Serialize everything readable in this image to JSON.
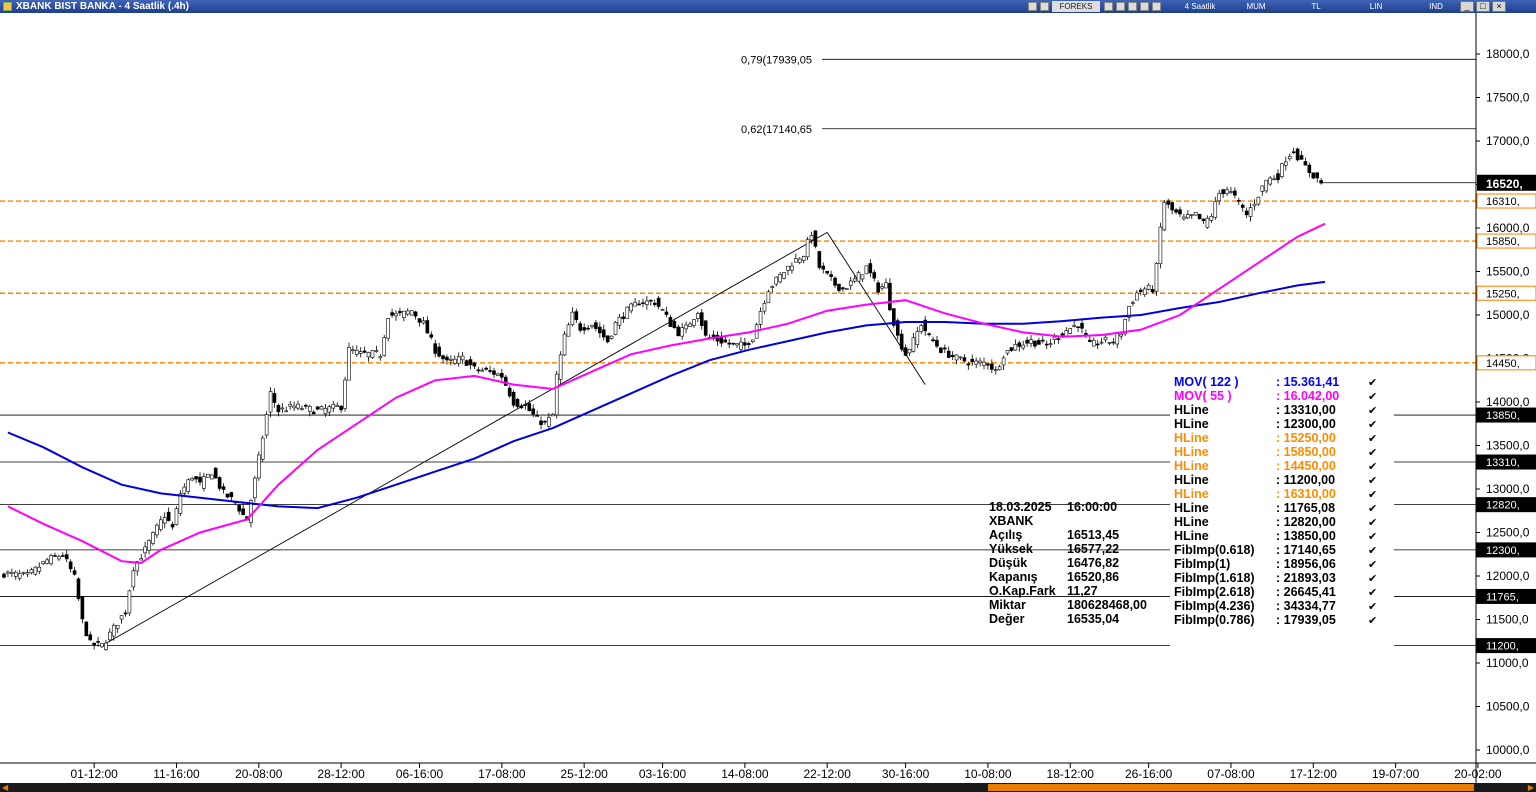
{
  "window": {
    "title": "XBANK BIST BANKA - 4 Saatlik (.4h)",
    "toolbar": {
      "source": "FOREKS",
      "period": "4 Saatlik",
      "chart_style": "MUM",
      "currency": "TL",
      "scale": "LIN",
      "indicators": "IND"
    },
    "buttons": {
      "minimize": "_",
      "maximize": "□",
      "close": "×"
    }
  },
  "chart_data": {
    "type": "candlestick",
    "symbol": "XBANK",
    "y_axis": {
      "range": [
        9800,
        18400
      ],
      "ticks": [
        "10000,0",
        "10500,0",
        "11000,0",
        "11500,0",
        "12000,0",
        "12500,0",
        "13000,0",
        "13500,0",
        "14000,0",
        "14500,0",
        "15000,0",
        "15500,0",
        "16000,0",
        "16500,0",
        "17000,0",
        "17500,0",
        "18000,0"
      ],
      "tick_values": [
        10000,
        10500,
        11000,
        11500,
        12000,
        12500,
        13000,
        13500,
        14000,
        14500,
        15000,
        15500,
        16000,
        16500,
        17000,
        17500,
        18000
      ]
    },
    "x_axis": {
      "bar_count": 370,
      "ticks": [
        "01-12:00",
        "11-16:00",
        "20-08:00",
        "28-12:00",
        "06-16:00",
        "17-08:00",
        "25-12:00",
        "03-16:00",
        "14-08:00",
        "22-12:00",
        "30-16:00",
        "10-08:00",
        "18-12:00",
        "26-16:00",
        "07-08:00",
        "17-12:00",
        "19-07:00",
        "20-02:00"
      ],
      "tick_bars": [
        23,
        44,
        65,
        86,
        106,
        127,
        148,
        168,
        189,
        210,
        230,
        251,
        272,
        292,
        313,
        334,
        355,
        376
      ]
    },
    "price_path": [
      [
        0,
        12030
      ],
      [
        6,
        12000
      ],
      [
        11,
        12180
      ],
      [
        15,
        12250
      ],
      [
        18,
        11980
      ],
      [
        20,
        11480
      ],
      [
        22,
        11220
      ],
      [
        25,
        11200
      ],
      [
        28,
        11400
      ],
      [
        31,
        11600
      ],
      [
        33,
        12100
      ],
      [
        36,
        12300
      ],
      [
        39,
        12550
      ],
      [
        41,
        12700
      ],
      [
        43,
        12550
      ],
      [
        45,
        12950
      ],
      [
        48,
        13150
      ],
      [
        50,
        13050
      ],
      [
        53,
        13200
      ],
      [
        56,
        12950
      ],
      [
        59,
        12850
      ],
      [
        61,
        12700
      ],
      [
        62,
        12650
      ],
      [
        64,
        13100
      ],
      [
        66,
        13600
      ],
      [
        68,
        14100
      ],
      [
        70,
        13900
      ],
      [
        74,
        13950
      ],
      [
        80,
        13900
      ],
      [
        86,
        13950
      ],
      [
        88,
        14600
      ],
      [
        91,
        14550
      ],
      [
        96,
        14550
      ],
      [
        98,
        15000
      ],
      [
        101,
        15000
      ],
      [
        104,
        15050
      ],
      [
        107,
        14900
      ],
      [
        110,
        14600
      ],
      [
        113,
        14450
      ],
      [
        117,
        14500
      ],
      [
        120,
        14380
      ],
      [
        124,
        14350
      ],
      [
        127,
        14300
      ],
      [
        130,
        14000
      ],
      [
        133,
        13950
      ],
      [
        136,
        13800
      ],
      [
        138,
        13750
      ],
      [
        140,
        13850
      ],
      [
        141,
        14300
      ],
      [
        143,
        14750
      ],
      [
        145,
        15000
      ],
      [
        147,
        14850
      ],
      [
        150,
        14900
      ],
      [
        154,
        14700
      ],
      [
        156,
        14900
      ],
      [
        159,
        15050
      ],
      [
        162,
        15150
      ],
      [
        166,
        15150
      ],
      [
        168,
        15050
      ],
      [
        170,
        14900
      ],
      [
        172,
        14800
      ],
      [
        174,
        14850
      ],
      [
        177,
        15050
      ],
      [
        179,
        14750
      ],
      [
        183,
        14700
      ],
      [
        186,
        14650
      ],
      [
        189,
        14650
      ],
      [
        191,
        14750
      ],
      [
        193,
        15050
      ],
      [
        195,
        15300
      ],
      [
        198,
        15450
      ],
      [
        201,
        15600
      ],
      [
        204,
        15700
      ],
      [
        206,
        15950
      ],
      [
        208,
        15550
      ],
      [
        210,
        15450
      ],
      [
        212,
        15350
      ],
      [
        214,
        15300
      ],
      [
        217,
        15400
      ],
      [
        220,
        15550
      ],
      [
        223,
        15300
      ],
      [
        225,
        15350
      ],
      [
        226,
        15100
      ],
      [
        228,
        14750
      ],
      [
        230,
        14550
      ],
      [
        232,
        14700
      ],
      [
        234,
        14900
      ],
      [
        236,
        14750
      ],
      [
        239,
        14600
      ],
      [
        243,
        14500
      ],
      [
        247,
        14450
      ],
      [
        251,
        14450
      ],
      [
        253,
        14350
      ],
      [
        255,
        14550
      ],
      [
        258,
        14650
      ],
      [
        262,
        14700
      ],
      [
        266,
        14650
      ],
      [
        270,
        14800
      ],
      [
        274,
        14900
      ],
      [
        277,
        14650
      ],
      [
        280,
        14700
      ],
      [
        283,
        14700
      ],
      [
        285,
        14800
      ],
      [
        287,
        15100
      ],
      [
        289,
        15250
      ],
      [
        291,
        15300
      ],
      [
        293,
        15300
      ],
      [
        294,
        15550
      ],
      [
        295,
        16000
      ],
      [
        296,
        16300
      ],
      [
        298,
        16200
      ],
      [
        301,
        16100
      ],
      [
        304,
        16150
      ],
      [
        306,
        16050
      ],
      [
        308,
        16150
      ],
      [
        310,
        16400
      ],
      [
        312,
        16450
      ],
      [
        314,
        16350
      ],
      [
        317,
        16150
      ],
      [
        319,
        16300
      ],
      [
        322,
        16550
      ],
      [
        325,
        16600
      ],
      [
        327,
        16800
      ],
      [
        329,
        16900
      ],
      [
        331,
        16750
      ],
      [
        333,
        16650
      ],
      [
        336,
        16520
      ]
    ],
    "series": [
      {
        "name": "MOV( 122 )",
        "color": "#0000dd",
        "points": [
          [
            1,
            13650
          ],
          [
            10,
            13480
          ],
          [
            20,
            13250
          ],
          [
            30,
            13050
          ],
          [
            40,
            12950
          ],
          [
            50,
            12900
          ],
          [
            60,
            12850
          ],
          [
            70,
            12800
          ],
          [
            80,
            12780
          ],
          [
            90,
            12900
          ],
          [
            100,
            13050
          ],
          [
            110,
            13200
          ],
          [
            120,
            13350
          ],
          [
            130,
            13550
          ],
          [
            140,
            13700
          ],
          [
            150,
            13900
          ],
          [
            160,
            14100
          ],
          [
            170,
            14300
          ],
          [
            180,
            14480
          ],
          [
            190,
            14600
          ],
          [
            200,
            14700
          ],
          [
            210,
            14800
          ],
          [
            220,
            14880
          ],
          [
            230,
            14920
          ],
          [
            240,
            14920
          ],
          [
            250,
            14900
          ],
          [
            260,
            14900
          ],
          [
            270,
            14930
          ],
          [
            280,
            14970
          ],
          [
            290,
            15000
          ],
          [
            300,
            15080
          ],
          [
            310,
            15150
          ],
          [
            320,
            15250
          ],
          [
            330,
            15340
          ],
          [
            337,
            15380
          ]
        ]
      },
      {
        "name": "MOV( 55 )",
        "color": "#ff00ff",
        "points": [
          [
            1,
            12800
          ],
          [
            10,
            12600
          ],
          [
            20,
            12400
          ],
          [
            30,
            12170
          ],
          [
            35,
            12150
          ],
          [
            40,
            12300
          ],
          [
            50,
            12500
          ],
          [
            62,
            12650
          ],
          [
            70,
            13050
          ],
          [
            80,
            13450
          ],
          [
            90,
            13750
          ],
          [
            100,
            14050
          ],
          [
            110,
            14250
          ],
          [
            120,
            14300
          ],
          [
            130,
            14200
          ],
          [
            140,
            14150
          ],
          [
            150,
            14350
          ],
          [
            160,
            14550
          ],
          [
            170,
            14650
          ],
          [
            180,
            14730
          ],
          [
            190,
            14800
          ],
          [
            200,
            14900
          ],
          [
            210,
            15050
          ],
          [
            220,
            15120
          ],
          [
            230,
            15170
          ],
          [
            240,
            15020
          ],
          [
            250,
            14900
          ],
          [
            260,
            14800
          ],
          [
            270,
            14750
          ],
          [
            280,
            14770
          ],
          [
            290,
            14830
          ],
          [
            300,
            15000
          ],
          [
            310,
            15300
          ],
          [
            320,
            15600
          ],
          [
            330,
            15900
          ],
          [
            337,
            16050
          ]
        ]
      }
    ],
    "horizontal_lines": [
      {
        "name": "HLine",
        "value": 13850.0,
        "axis_label": "13850,"
      },
      {
        "name": "HLine",
        "value": 13310.0,
        "axis_label": "13310,"
      },
      {
        "name": "HLine",
        "value": 12820.0,
        "axis_label": "12820,"
      },
      {
        "name": "HLine",
        "value": 12300.0,
        "axis_label": "12300,"
      },
      {
        "name": "HLine",
        "value": 11765.08,
        "axis_label": "11765,"
      },
      {
        "name": "HLine",
        "value": 11200.0,
        "axis_label": "11200,"
      },
      {
        "name": "HLine",
        "value": 16310.0,
        "axis_label": "16310,",
        "color": "#ff7f00",
        "dashed": true
      },
      {
        "name": "HLine",
        "value": 15850.0,
        "axis_label": "15850,",
        "color": "#ff7f00",
        "dashed": true
      },
      {
        "name": "HLine",
        "value": 15250.0,
        "axis_label": "15250,",
        "color": "#ff7f00",
        "dashed": true
      },
      {
        "name": "HLine",
        "value": 14450.0,
        "axis_label": "14450,",
        "color": "#ff7f00",
        "dashed": true
      }
    ],
    "fib_levels": [
      {
        "label": "0,79(17939,05",
        "value": 17939.05
      },
      {
        "label": "0,62(17140,65",
        "value": 17140.65
      }
    ],
    "trend_lines": [
      {
        "from": [
          25,
          11200
        ],
        "to": [
          210,
          15950
        ]
      },
      {
        "from": [
          210,
          15950
        ],
        "to": [
          235,
          14200
        ]
      }
    ],
    "last_price": {
      "label": "16520,",
      "value": 16520
    },
    "ohlc_box": {
      "rows": [
        [
          "18.03.2025",
          "16:00:00"
        ],
        [
          "XBANK",
          ""
        ],
        [
          "Açılış",
          "16513,45"
        ],
        [
          "Yüksek",
          "16577,22"
        ],
        [
          "Düşük",
          "16476,82"
        ],
        [
          "Kapanış",
          "16520,86"
        ],
        [
          "O.Kap.Fark",
          "11,27"
        ],
        [
          "Miktar",
          "180628468,00"
        ],
        [
          "Değer",
          "16535,04"
        ]
      ]
    },
    "legend": {
      "position": "right",
      "rows": [
        {
          "name": "MOV( 122 )",
          "value": ": 15.361,41",
          "color": "#0000ff"
        },
        {
          "name": "MOV( 55 )",
          "value": ": 16.042,00",
          "color": "#ff00ff"
        },
        {
          "name": "HLine",
          "value": ": 13310,00",
          "color": "#000000"
        },
        {
          "name": "HLine",
          "value": ": 12300,00",
          "color": "#000000"
        },
        {
          "name": "HLine",
          "value": ": 15250,00",
          "color": "#ff8c00"
        },
        {
          "name": "HLine",
          "value": ": 15850,00",
          "color": "#ff8c00"
        },
        {
          "name": "HLine",
          "value": ": 14450,00",
          "color": "#ff8c00"
        },
        {
          "name": "HLine",
          "value": ": 11200,00",
          "color": "#000000"
        },
        {
          "name": "HLine",
          "value": ": 16310,00",
          "color": "#ff8c00"
        },
        {
          "name": "HLine",
          "value": ": 11765,08",
          "color": "#000000"
        },
        {
          "name": "HLine",
          "value": ": 12820,00",
          "color": "#000000"
        },
        {
          "name": "HLine",
          "value": ": 13850,00",
          "color": "#000000"
        },
        {
          "name": "FibImp(0.618)",
          "value": ": 17140,65",
          "color": "#000000"
        },
        {
          "name": "FibImp(1)",
          "value": ": 18956,06",
          "color": "#000000"
        },
        {
          "name": "FibImp(1.618)",
          "value": ": 21893,03",
          "color": "#000000"
        },
        {
          "name": "FibImp(2.618)",
          "value": ": 26645,41",
          "color": "#000000"
        },
        {
          "name": "FibImp(4.236)",
          "value": ": 34334,77",
          "color": "#000000"
        },
        {
          "name": "FibImp(0.786)",
          "value": ": 17939,05",
          "color": "#000000"
        }
      ],
      "check_mark": "✔"
    },
    "colors": {
      "up": "#ffffff",
      "down": "#000000",
      "orange": "#ff7f00",
      "axis_bg": "#ffffff",
      "accent": "#1f3f8a"
    },
    "grid": false
  }
}
